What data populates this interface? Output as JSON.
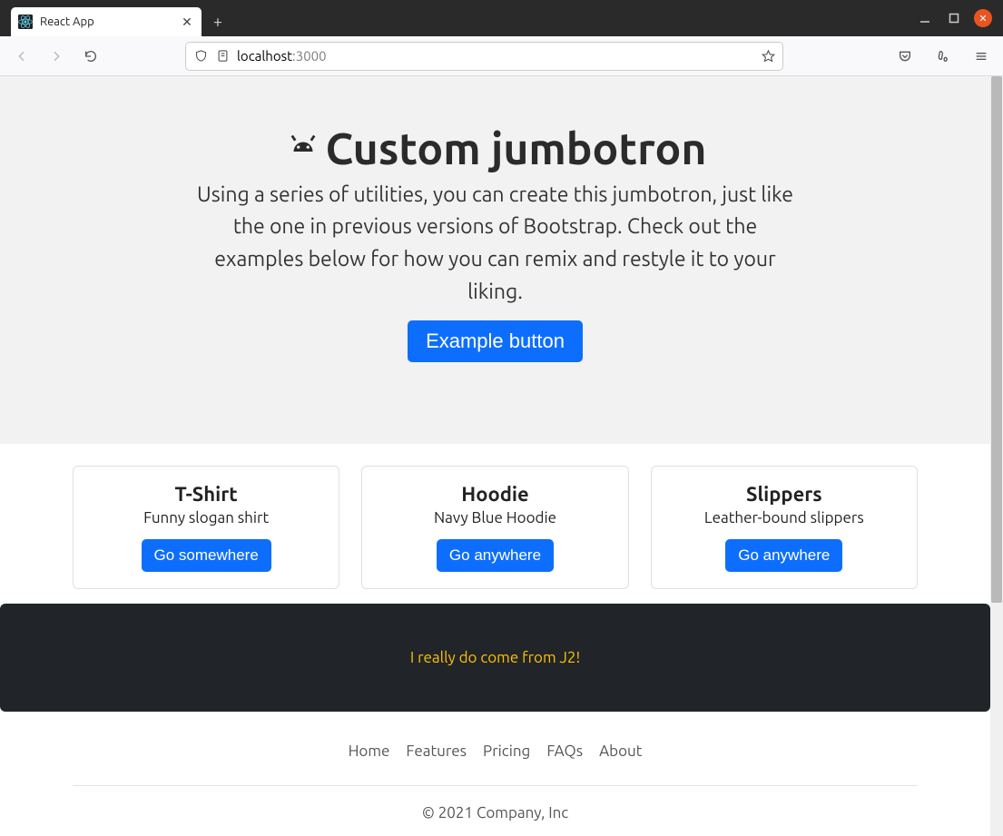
{
  "browser": {
    "tab_title": "React App",
    "url_host": "localhost",
    "url_port": ":3000"
  },
  "jumbotron": {
    "title": "Custom jumbotron",
    "lead": "Using a series of utilities, you can create this jumbotron, just like the one in previous versions of Bootstrap. Check out the examples below for how you can remix and restyle it to your liking.",
    "button": "Example button"
  },
  "cards": [
    {
      "title": "T-Shirt",
      "desc": "Funny slogan shirt",
      "btn": "Go somewhere"
    },
    {
      "title": "Hoodie",
      "desc": "Navy Blue Hoodie",
      "btn": "Go anywhere"
    },
    {
      "title": "Slippers",
      "desc": "Leather-bound slippers",
      "btn": "Go anywhere"
    }
  ],
  "banner": {
    "text": "I really do come from J2!"
  },
  "footer": {
    "links": [
      "Home",
      "Features",
      "Pricing",
      "FAQs",
      "About"
    ],
    "copyright": "© 2021 Company, Inc"
  }
}
